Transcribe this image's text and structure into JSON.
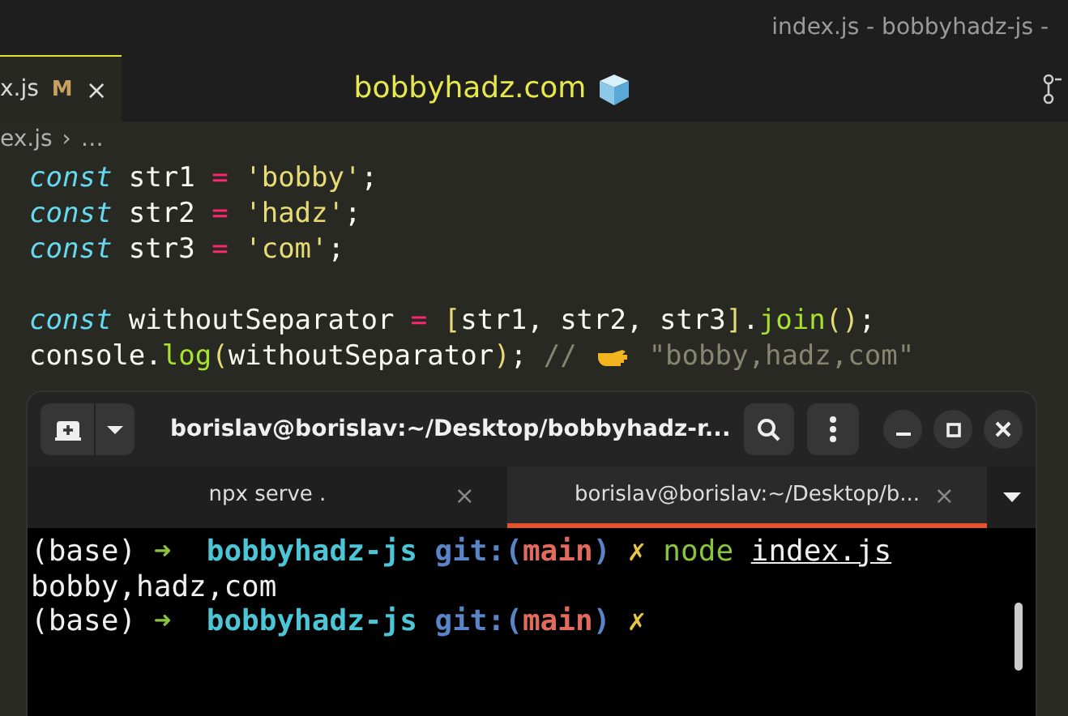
{
  "window": {
    "title": "index.js - bobbyhadz-js -"
  },
  "editor_tab": {
    "label": "x.js",
    "badge": "M",
    "close": "×",
    "selected": true
  },
  "banner": {
    "text": "bobbyhadz.com"
  },
  "breadcrumb": {
    "file": "ex.js",
    "separator": "›",
    "more": "…"
  },
  "code_blocks": [
    [
      [
        {
          "kind": "keyword",
          "text": "const"
        },
        {
          "kind": "ident",
          "text": " str1 "
        },
        {
          "kind": "op",
          "text": "= "
        },
        {
          "kind": "string",
          "text": "'bobby'"
        },
        {
          "kind": "punct",
          "text": ";"
        }
      ],
      [
        {
          "kind": "keyword",
          "text": "const"
        },
        {
          "kind": "ident",
          "text": " str2 "
        },
        {
          "kind": "op",
          "text": "= "
        },
        {
          "kind": "string",
          "text": "'hadz'"
        },
        {
          "kind": "punct",
          "text": ";"
        }
      ],
      [
        {
          "kind": "keyword",
          "text": "const"
        },
        {
          "kind": "ident",
          "text": " str3 "
        },
        {
          "kind": "op",
          "text": "= "
        },
        {
          "kind": "string",
          "text": "'com'"
        },
        {
          "kind": "punct",
          "text": ";"
        }
      ]
    ],
    [
      [
        {
          "kind": "keyword",
          "text": "const"
        },
        {
          "kind": "ident",
          "text": " withoutSeparator "
        },
        {
          "kind": "op",
          "text": "= "
        },
        {
          "kind": "bracket",
          "text": "["
        },
        {
          "kind": "ident",
          "text": "str1, str2, str3"
        },
        {
          "kind": "bracket",
          "text": "]"
        },
        {
          "kind": "punct",
          "text": "."
        },
        {
          "kind": "func",
          "text": "join"
        },
        {
          "kind": "bracket",
          "text": "()"
        },
        {
          "kind": "punct",
          "text": ";"
        }
      ],
      [
        {
          "kind": "ident",
          "text": "console."
        },
        {
          "kind": "func",
          "text": "log"
        },
        {
          "kind": "bracket",
          "text": "("
        },
        {
          "kind": "ident",
          "text": "withoutSeparator"
        },
        {
          "kind": "bracket",
          "text": ")"
        },
        {
          "kind": "punct",
          "text": "; "
        },
        {
          "kind": "comment",
          "text": "// "
        },
        {
          "kind": "emoji"
        },
        {
          "kind": "comment",
          "text": " \"bobby,hadz,com\""
        }
      ]
    ]
  ],
  "terminal": {
    "title": "borislav@borislav:~/Desktop/bobbyhadz-r...",
    "tabs": [
      {
        "label": "npx serve .",
        "close": "×",
        "selected": false
      },
      {
        "label": "borislav@borislav:~/Desktop/b...",
        "close": "×",
        "selected": true
      }
    ],
    "lines": [
      [
        {
          "kind": "plain",
          "text": "(base) "
        },
        {
          "kind": "arrow",
          "text": "➜"
        },
        {
          "kind": "dir",
          "text": "  bobbyhadz-js"
        },
        {
          "kind": "git",
          "text": " git:("
        },
        {
          "kind": "branch",
          "text": "main"
        },
        {
          "kind": "git",
          "text": ")"
        },
        {
          "kind": "mark",
          "text": " ✗"
        },
        {
          "kind": "cmd",
          "text": " node "
        },
        {
          "kind": "arg",
          "text": "index.js"
        }
      ],
      [
        {
          "kind": "plain",
          "text": "bobby,hadz,com"
        }
      ],
      [
        {
          "kind": "plain",
          "text": "(base) "
        },
        {
          "kind": "arrow",
          "text": "➜"
        },
        {
          "kind": "dir",
          "text": "  bobbyhadz-js"
        },
        {
          "kind": "git",
          "text": " git:("
        },
        {
          "kind": "branch",
          "text": "main"
        },
        {
          "kind": "git",
          "text": ")"
        },
        {
          "kind": "mark",
          "text": " ✗"
        }
      ]
    ]
  }
}
